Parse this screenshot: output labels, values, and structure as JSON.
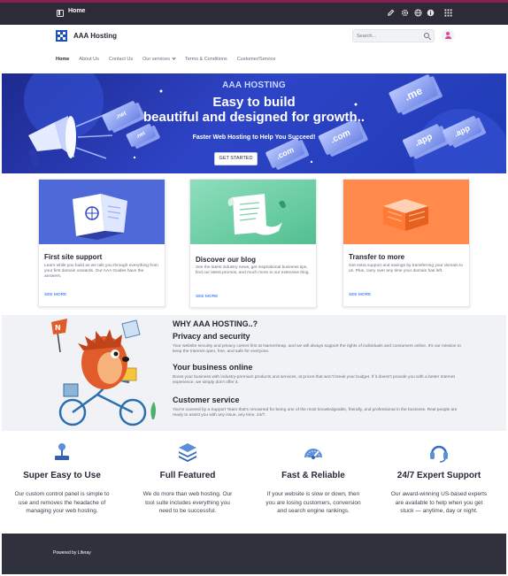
{
  "topbar": {
    "home_label": "Home",
    "icons": [
      "panel-icon",
      "pencil-icon",
      "gear-icon",
      "globe-icon",
      "info-icon",
      "apps-grid-icon"
    ]
  },
  "header": {
    "brand": "AAA Hosting",
    "search_placeholder": "Search...",
    "nav": [
      "Home",
      "About Us",
      "Contact Us",
      "Our services",
      "Terms & Conditions",
      "Customer/Service"
    ]
  },
  "hero": {
    "small_title": "AAA HOSTING",
    "title_line1": "Easy to build",
    "title_line2": "beautiful and designed for growth..",
    "subtitle": "Faster Web Hosting to Help You Succeed!",
    "cta": "GET STARTED",
    "domain_blocks": [
      ".me",
      ".com",
      ".net",
      ".app",
      ".app",
      ".com",
      ".net"
    ]
  },
  "cards": [
    {
      "title": "First site support",
      "text": "Learn while you build as we talk you through everything from your first domain onwards. Our AAA Guides have the answers.",
      "more": "SEE MORE"
    },
    {
      "title": "Discover our blog",
      "text": "See the latest industry news, get inspirational business tips, find our latest promos, and much more in our extensive blog.",
      "more": "SEE MORE"
    },
    {
      "title": "Transfer to more",
      "text": "Get extra support and savings by transferring your domain to us. Plus, carry over any time your domain has left.",
      "more": "SEE MORE"
    }
  ],
  "why": {
    "heading": "WHY AAA HOSTING..?",
    "sections": [
      {
        "title": "Privacy and security",
        "text": "Your website security and privacy comes first at Namecheap, and we will always support the rights of individuals and consumers online. It's our mission to keep the Internet open, free, and safe for everyone."
      },
      {
        "title": "Your business online",
        "text": "Boost your business with industry-premium products and services, at prices that won't break your budget. If it doesn't provide you with a better Internet experience, we simply don't offer it."
      },
      {
        "title": "Customer service",
        "text": "You're covered by a Support Team that's renowned for being one of the most knowledgeable, friendly, and professional in the business. Real people are ready to assist you with any issue, any time, 24/7."
      }
    ]
  },
  "features": [
    {
      "icon": "joystick-icon",
      "title": "Super Easy to Use",
      "text": "Our custom control panel is simple to use and removes the headache of managing your web hosting."
    },
    {
      "icon": "layers-icon",
      "title": "Full Featured",
      "text": "We do more than web hosting. Our tool suite includes everything you need to be successful."
    },
    {
      "icon": "speedometer-icon",
      "title": "Fast & Reliable",
      "text": "If your website is slow or down, then you are losing customers, conversion and search engine rankings."
    },
    {
      "icon": "headset-icon",
      "title": "24/7 Expert Support",
      "text": "Our award-winning US-based experts are available to help when you get stuck — anytime, day or night."
    }
  ],
  "footer": {
    "powered_by": "Powered by Liferay"
  },
  "colors": {
    "accent": "#0b5fff",
    "hero_blue": "#2e44c7",
    "card1_bg": "#4f6ad8",
    "card2_bg": "#5fd0a0",
    "card3_bg": "#ff8a4c",
    "footer_bg": "#2f313d"
  }
}
